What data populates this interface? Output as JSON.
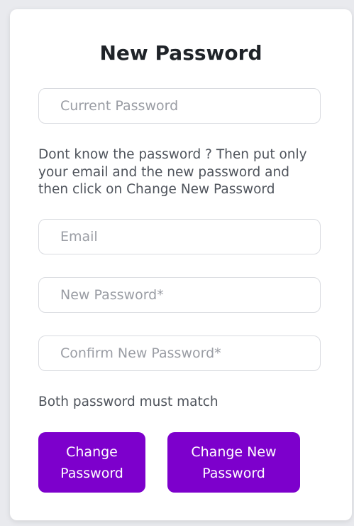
{
  "form": {
    "title": "New Password",
    "current_password": {
      "placeholder": "Current Password",
      "value": ""
    },
    "help_text": "Dont know the password ? Then put only your email and the new password and then click on Change New Password",
    "email": {
      "placeholder": "Email",
      "value": ""
    },
    "new_password": {
      "placeholder": "New Password*",
      "value": ""
    },
    "confirm_password": {
      "placeholder": "Confirm New Password*",
      "value": ""
    },
    "match_hint": "Both password must match",
    "change_password_label": "Change Password",
    "change_new_password_label": "Change New Password"
  },
  "colors": {
    "accent": "#7d00cc",
    "background": "#e9eaee",
    "card": "#ffffff"
  }
}
